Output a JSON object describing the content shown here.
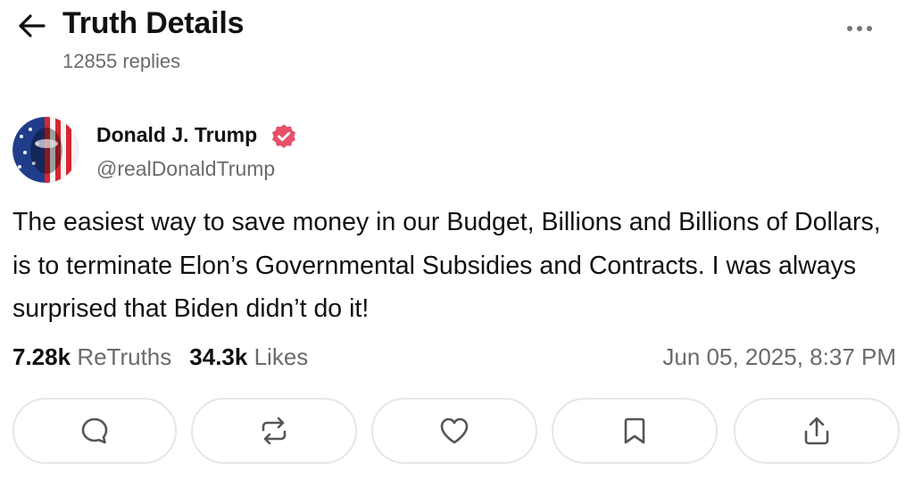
{
  "header": {
    "title": "Truth Details",
    "reply_count": "12855",
    "reply_label": "replies"
  },
  "post": {
    "author_name": "Donald J. Trump",
    "handle": "@realDonaldTrump",
    "text": "The easiest way to save money in our Budget, Billions and Billions of Dollars, is to terminate Elon’s Governmental Subsidies and Contracts. I was always surprised that Biden didn’t do it!",
    "retruths_count": "7.28k",
    "retruths_label": "ReTruths",
    "likes_count": "34.3k",
    "likes_label": "Likes",
    "timestamp": "Jun 05, 2025, 8:37 PM"
  },
  "icons": {
    "back": "arrow-left-icon",
    "more": "more-horizontal-icon",
    "verified": "verified-badge-icon",
    "reply": "comment-icon",
    "retruth": "repost-icon",
    "like": "heart-icon",
    "bookmark": "bookmark-icon",
    "share": "share-icon"
  },
  "colors": {
    "verified_badge": "#e8506a",
    "muted_text": "#6b6b6b",
    "button_border": "#e6e6e6",
    "icon_stroke": "#555555"
  }
}
